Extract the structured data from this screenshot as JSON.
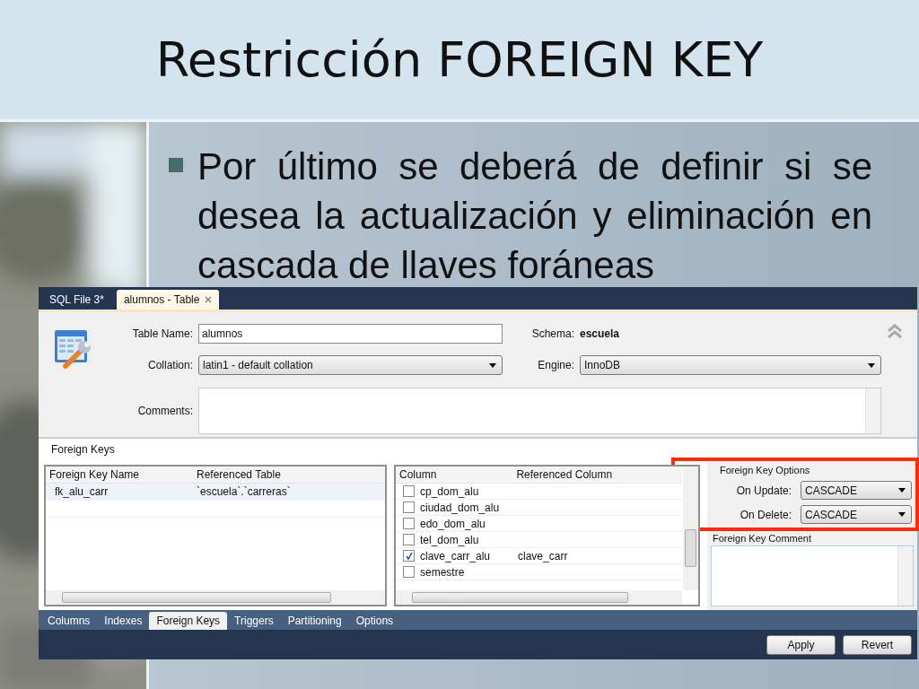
{
  "slide": {
    "title": "Restricción FOREIGN KEY",
    "bullets": [
      "Por último se deberá de definir si se desea la actualización y eliminación en cascada de llaves foráneas"
    ]
  },
  "window": {
    "tabs": [
      {
        "label": "SQL File 3*",
        "selected": false,
        "closable": false
      },
      {
        "label": "alumnos - Table",
        "selected": true,
        "closable": true
      }
    ],
    "table_name": {
      "label": "Table Name:",
      "value": "alumnos"
    },
    "schema": {
      "label": "Schema:",
      "value": "escuela"
    },
    "collation": {
      "label": "Collation:",
      "value": "latin1 - default collation"
    },
    "engine": {
      "label": "Engine:",
      "value": "InnoDB"
    },
    "comments": {
      "label": "Comments:"
    },
    "section_title": "Foreign Keys",
    "fk_table": {
      "columns": [
        "Foreign Key Name",
        "Referenced Table"
      ],
      "rows": [
        {
          "cells": [
            "fk_alu_carr",
            "`escuela`.`carreras`"
          ],
          "selected": true
        }
      ]
    },
    "column_table": {
      "columns": [
        "Column",
        "Referenced Column"
      ],
      "rows": [
        {
          "name": "cp_dom_alu",
          "checked": false
        },
        {
          "name": "ciudad_dom_alu",
          "checked": false
        },
        {
          "name": "edo_dom_alu",
          "checked": false
        },
        {
          "name": "tel_dom_alu",
          "checked": false
        },
        {
          "name": "clave_carr_alu",
          "checked": true,
          "referenced": "clave_carr"
        },
        {
          "name": "semestre",
          "checked": false
        }
      ]
    },
    "options": {
      "title": "Foreign Key Options",
      "highlighted": true,
      "on_update": {
        "label": "On Update:",
        "value": "CASCADE"
      },
      "on_delete": {
        "label": "On Delete:",
        "value": "CASCADE"
      },
      "comment_label": "Foreign Key Comment"
    },
    "bottom_tabs": [
      {
        "label": "Columns",
        "selected": false
      },
      {
        "label": "Indexes",
        "selected": false
      },
      {
        "label": "Foreign Keys",
        "selected": true
      },
      {
        "label": "Triggers",
        "selected": false
      },
      {
        "label": "Partitioning",
        "selected": false
      },
      {
        "label": "Options",
        "selected": false
      }
    ],
    "buttons": [
      "Apply",
      "Revert"
    ]
  }
}
